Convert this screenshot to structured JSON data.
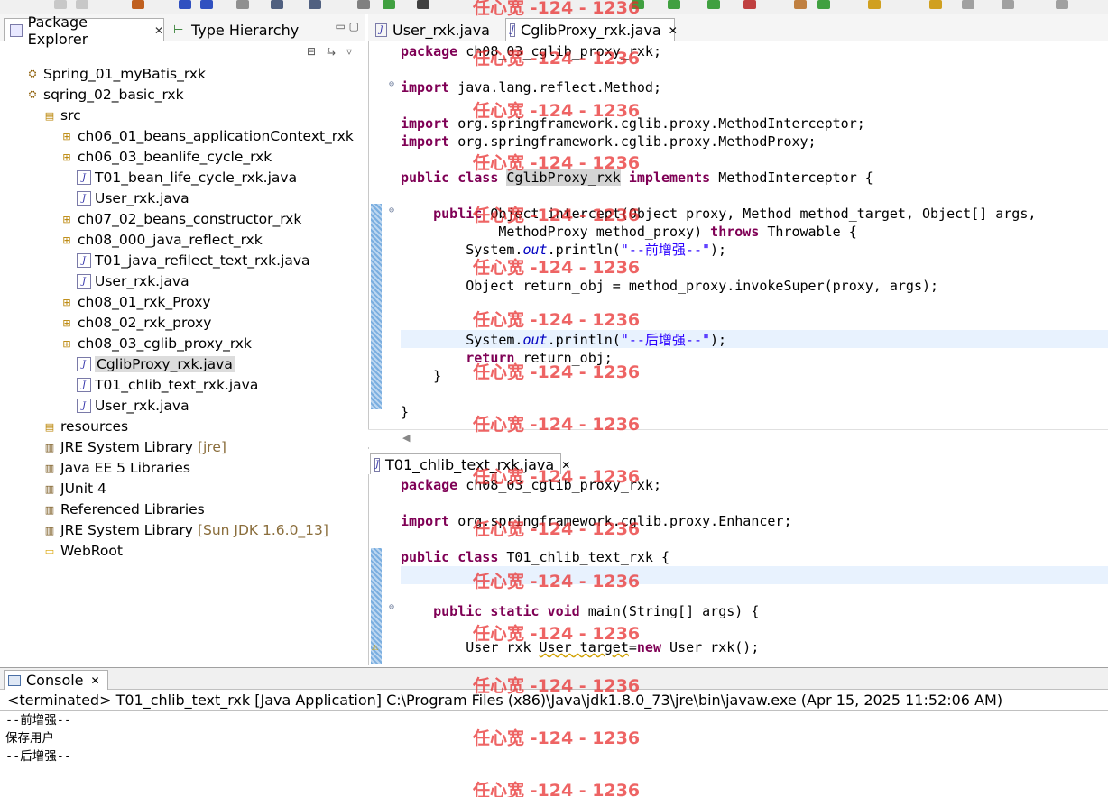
{
  "package_explorer": {
    "tabs": [
      {
        "label": "Package Explorer"
      },
      {
        "label": "Type Hierarchy"
      }
    ],
    "tree": [
      {
        "label": "Spring_01_myBatis_rxk",
        "icon": "project-icon"
      },
      {
        "label": "sqring_02_basic_rxk",
        "icon": "project-icon"
      },
      {
        "label": "src",
        "icon": "source-folder-icon"
      },
      {
        "label": "ch06_01_beans_applicationContext_rxk",
        "icon": "package-icon"
      },
      {
        "label": "ch06_03_beanlife_cycle_rxk",
        "icon": "package-icon"
      },
      {
        "label": "T01_bean_life_cycle_rxk.java",
        "icon": "java-file-icon"
      },
      {
        "label": "User_rxk.java",
        "icon": "java-file-icon"
      },
      {
        "label": "ch07_02_beans_constructor_rxk",
        "icon": "package-icon"
      },
      {
        "label": "ch08_000_java_reflect_rxk",
        "icon": "package-icon"
      },
      {
        "label": "T01_java_refilect_text_rxk.java",
        "icon": "java-file-icon"
      },
      {
        "label": "User_rxk.java",
        "icon": "java-file-icon"
      },
      {
        "label": "ch08_01_rxk_Proxy",
        "icon": "package-icon"
      },
      {
        "label": "ch08_02_rxk_proxy",
        "icon": "package-icon"
      },
      {
        "label": "ch08_03_cglib_proxy_rxk",
        "icon": "package-icon"
      },
      {
        "label": "CglibProxy_rxk.java",
        "icon": "java-file-icon",
        "selected": true
      },
      {
        "label": "T01_chlib_text_rxk.java",
        "icon": "java-file-icon"
      },
      {
        "label": "User_rxk.java",
        "icon": "java-file-icon"
      },
      {
        "label": "resources",
        "icon": "source-folder-icon"
      },
      {
        "label": "JRE System Library",
        "suffix": "[jre]",
        "icon": "library-icon"
      },
      {
        "label": "Java EE 5 Libraries",
        "icon": "library-icon"
      },
      {
        "label": "JUnit 4",
        "icon": "library-icon"
      },
      {
        "label": "Referenced Libraries",
        "icon": "library-icon"
      },
      {
        "label": "JRE System Library",
        "suffix": "[Sun JDK 1.6.0_13]",
        "icon": "library-icon"
      },
      {
        "label": "WebRoot",
        "icon": "folder-icon"
      }
    ]
  },
  "editor_top": {
    "tabs": [
      {
        "label": "User_rxk.java"
      },
      {
        "label": "CglibProxy_rxk.java"
      }
    ],
    "lines": [
      "package ch08_03_cglib_proxy_rxk;",
      "import java.lang.reflect.Method;",
      "import org.springframework.cglib.proxy.MethodInterceptor;",
      "import org.springframework.cglib.proxy.MethodProxy;",
      "public class CglibProxy_rxk implements MethodInterceptor {",
      "    public Object intercept(Object proxy, Method method_target, Object[] args,",
      "            MethodProxy method_proxy) throws Throwable {",
      "        System.out.println(\"--前增强--\");",
      "        Object return_obj = method_proxy.invokeSuper(proxy, args);",
      "        System.out.println(\"--后增强--\");",
      "        return return_obj;",
      "    }",
      "}"
    ]
  },
  "editor_bottom": {
    "tab": {
      "label": "T01_chlib_text_rxk.java"
    },
    "lines": [
      "package ch08_03_cglib_proxy_rxk;",
      "import org.springframework.cglib.proxy.Enhancer;",
      "public class T01_chlib_text_rxk {",
      "    public static void main(String[] args) {",
      "        User_rxk User_target=new User_rxk();"
    ]
  },
  "console": {
    "tab_label": "Console",
    "status": "<terminated> T01_chlib_text_rxk [Java Application] C:\\Program Files (x86)\\Java\\jdk1.8.0_73\\jre\\bin\\javaw.exe (Apr 15, 2025 11:52:06 AM)",
    "output": [
      "--前增强--",
      "保存用户",
      "--后增强--"
    ]
  },
  "watermark": "任心宽 -124 - 1236",
  "colors": {
    "keyword": "#7f0055",
    "string": "#2a00ff",
    "watermark": "#e82828"
  }
}
